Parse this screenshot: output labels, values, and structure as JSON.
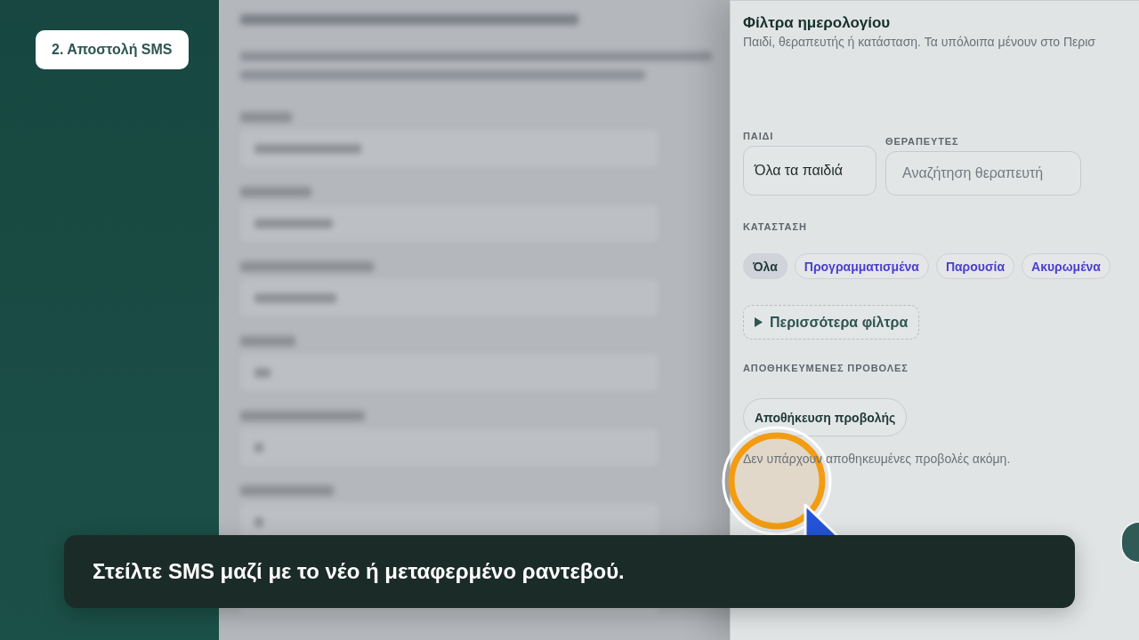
{
  "sidebar": {
    "step_badge": "2. Αποστολή SMS"
  },
  "filter_panel": {
    "title": "Φίλτρα ημερολογίου",
    "subtitle": "Παιδί, θεραπευτής ή κατάσταση. Τα υπόλοιπα μένουν στο Περισ",
    "child_filter": {
      "label": "ΠΑΙΔΙ",
      "value": "Όλα τα παιδιά"
    },
    "therapist_filter": {
      "label": "ΘΕΡΑΠΕΥΤΕΣ",
      "placeholder": "Αναζήτηση θεραπευτή"
    },
    "status": {
      "label": "ΚΑΤΑΣΤΑΣΗ",
      "chips": [
        {
          "label": "Όλα",
          "selected": true
        },
        {
          "label": "Προγραμματισμένα",
          "selected": false
        },
        {
          "label": "Παρουσία",
          "selected": false
        },
        {
          "label": "Ακυρωμένα",
          "selected": false
        }
      ]
    },
    "more_filters": {
      "label": "Περισσότερα φίλτρα",
      "expanded": false
    },
    "saved_views": {
      "label": "ΑΠΟΘΗΚΕΥΜΕΝΕΣ ΠΡΟΒΟΛΕΣ",
      "save_button": "Αποθήκευση προβολής",
      "empty_text": "Δεν υπάρχουν αποθηκευμένες προβολές ακόμη."
    }
  },
  "caption": "Στείλτε SMS μαζί με το νέο ή μεταφερμένο ραντεβού."
}
